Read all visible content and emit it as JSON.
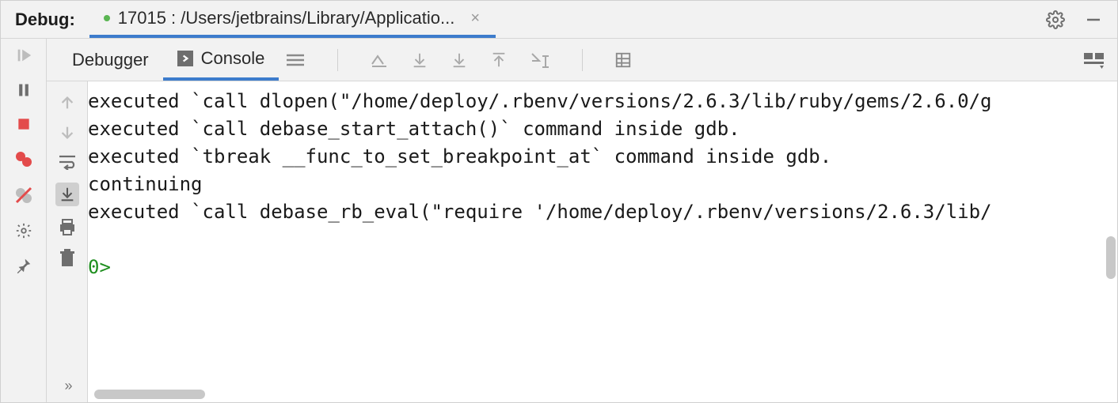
{
  "header": {
    "title": "Debug:",
    "session_label": "17015 : /Users/jetbrains/Library/Applicatio...",
    "gear_icon": "gear-icon",
    "minimize_icon": "minimize-icon",
    "close_tab_icon": "close-icon"
  },
  "left_toolbar": {
    "items": [
      {
        "name": "resume-button",
        "style": "resume"
      },
      {
        "name": "pause-button",
        "style": "pause"
      },
      {
        "name": "stop-button",
        "style": "stop"
      },
      {
        "name": "breakpoints-button",
        "style": "breakpoints"
      },
      {
        "name": "mute-breakpoints-button",
        "style": "mute"
      },
      {
        "name": "settings-button",
        "style": "gear"
      },
      {
        "name": "pin-button",
        "style": "pin"
      }
    ]
  },
  "subtabs": {
    "debugger_label": "Debugger",
    "console_label": "Console",
    "toolbar_icons": [
      "threads-icon",
      "step-out-icon",
      "download-icon",
      "download2-icon",
      "upload-icon",
      "step-into-cursor-icon",
      "table-icon"
    ],
    "layout_icon": "layout-icon"
  },
  "inner_toolbar": {
    "items": [
      {
        "name": "scroll-up-button",
        "style": "arrow-up",
        "enabled": false
      },
      {
        "name": "scroll-down-button",
        "style": "arrow-down",
        "enabled": false
      },
      {
        "name": "soft-wrap-button",
        "style": "wrap",
        "enabled": true
      },
      {
        "name": "scroll-to-end-button",
        "style": "scroll-end",
        "enabled": true,
        "toggled": true
      },
      {
        "name": "print-button",
        "style": "print",
        "enabled": true
      },
      {
        "name": "clear-all-button",
        "style": "trash",
        "enabled": true
      }
    ],
    "expand_icon": "expand-icon"
  },
  "console": {
    "lines": [
      "executed `call dlopen(\"/home/deploy/.rbenv/versions/2.6.3/lib/ruby/gems/2.6.0/g",
      "executed `call debase_start_attach()` command inside gdb.",
      "executed `tbreak __func_to_set_breakpoint_at` command inside gdb.",
      "continuing",
      "executed `call debase_rb_eval(\"require '/home/deploy/.rbenv/versions/2.6.3/lib/",
      ""
    ],
    "prompt": "0> "
  }
}
